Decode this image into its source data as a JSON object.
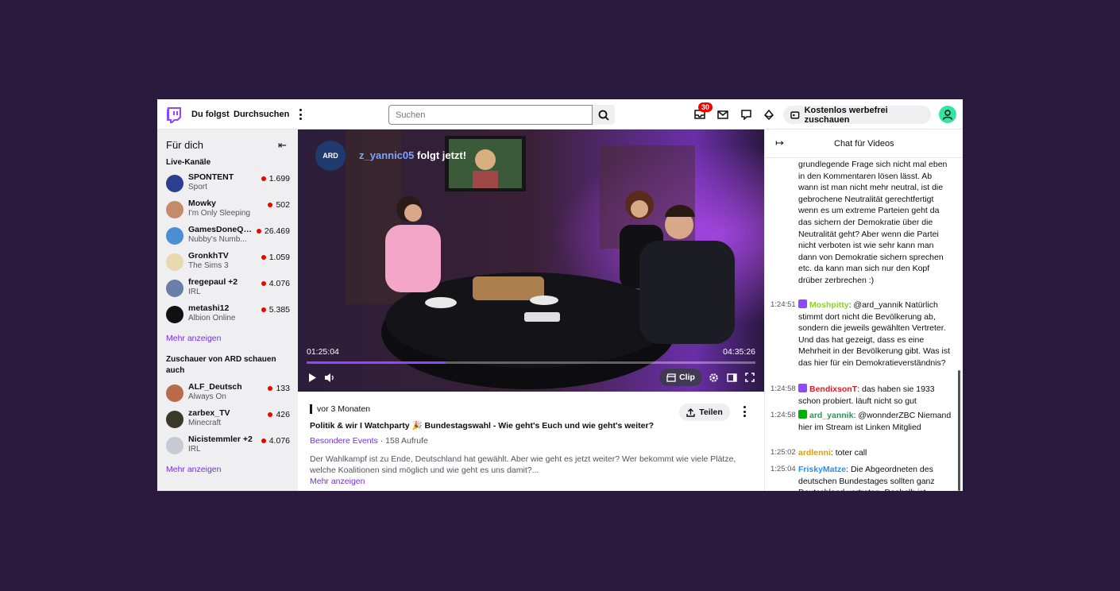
{
  "nav": {
    "follow": "Du folgst",
    "browse": "Durchsuchen",
    "search_placeholder": "Suchen",
    "notif_count": "30",
    "adfree": "Kostenlos werbefrei zuschauen"
  },
  "sidebar": {
    "title": "Für dich",
    "live_heading": "Live-Kanäle",
    "live_channels": [
      {
        "name": "SPONTENT",
        "category": "Sport",
        "viewers": "1.699",
        "color": "#2a3f8f"
      },
      {
        "name": "Mowky",
        "category": "I'm Only Sleeping",
        "viewers": "502",
        "color": "#c48a6a"
      },
      {
        "name": "GamesDoneQu...",
        "category": "Nubby's Numb...",
        "viewers": "26.469",
        "color": "#4a8fd4"
      },
      {
        "name": "GronkhTV",
        "category": "The Sims 3",
        "viewers": "1.059",
        "color": "#e8d9b0"
      },
      {
        "name": "fregepaul +2",
        "category": "IRL",
        "viewers": "4.076",
        "color": "#6a7fa8"
      },
      {
        "name": "metashi12",
        "category": "Albion Online",
        "viewers": "5.385",
        "color": "#111111"
      }
    ],
    "more1": "Mehr anzeigen",
    "ard_heading": "Zuschauer von ARD schauen auch",
    "ard_channels": [
      {
        "name": "ALF_Deutsch",
        "category": "Always On",
        "viewers": "133",
        "color": "#b86a4a"
      },
      {
        "name": "zarbex_TV",
        "category": "Minecraft",
        "viewers": "426",
        "color": "#3a3a2a"
      },
      {
        "name": "Nicistemmler +2",
        "category": "IRL",
        "viewers": "4.076",
        "color": "#d8d8e0"
      }
    ],
    "more2": "Mehr anzeigen"
  },
  "video": {
    "overlay_user": "z_yannic05",
    "overlay_action": "folgt jetzt!",
    "ard_logo": "ARD",
    "time_current": "01:25:04",
    "time_total": "04:35:26",
    "progress": 0.31,
    "clip_label": "Clip"
  },
  "info": {
    "age": "vor 3 Monaten",
    "title": "Politik & wir I Watchparty 🎉 Bundestagswahl - Wie geht's Euch und wie geht's weiter?",
    "category": "Besondere Events",
    "views": " · 158 Aufrufe",
    "description": "Der Wahlkampf ist zu Ende, Deutschland hat gewählt. Aber wie geht es jetzt weiter? Wer bekommt wie viele Plätze, welche Koalitionen sind möglich und wie geht es uns damit?...",
    "more": "Mehr anzeigen",
    "share": "Teilen"
  },
  "chat": {
    "title": "Chat für Videos",
    "continued": "grundlegende Frage sich nicht mal eben in den Kommentaren lösen lässt. Ab wann ist man nicht mehr neutral, ist die gebrochene Neutralität gerechtfertigt wenn es um extreme Parteien geht da das sichern der Demokratie über die Neutralität geht? Aber wenn die Partei nicht verboten ist wie sehr kann man dann von Demokratie sichern sprechen etc. da kann man sich nur den Kopf drüber zerbrechen :)",
    "messages": [
      {
        "time": "1:24:51",
        "user": "Moshpitty",
        "color": "#8fcf2a",
        "badge": "#9147ff",
        "text": "@ard_yannik Natürlich stimmt dort nicht die Bevölkerung ab, sondern die jeweils gewählten Vertreter. Und das hat gezeigt, dass es eine Mehrheit in der Bevölkerung gibt. Was ist das hier für ein Demokratieverständnis?"
      },
      {
        "time": "1:24:58",
        "user": "BendixsonT",
        "color": "#e0182a",
        "badge": "#9147ff",
        "text": "das haben sie 1933 schon probiert. läuft nicht so gut"
      },
      {
        "time": "1:24:58",
        "user": "ard_yannik",
        "color": "#1e9c4b",
        "badge": "#00ad03",
        "text": "@wonnderZBC Niemand hier im Stream ist Linken Mitglied"
      },
      {
        "time": "1:25:02",
        "user": "ardlenni",
        "color": "#d4a017",
        "badge": "",
        "text": "toter call"
      },
      {
        "time": "1:25:04",
        "user": "FriskyMatze",
        "color": "#1e90ff",
        "badge": "",
        "text": "Die Abgeordneten des deutschen Bundestages sollten ganz Deutschland vertreten. Deshalb ist"
      }
    ]
  }
}
